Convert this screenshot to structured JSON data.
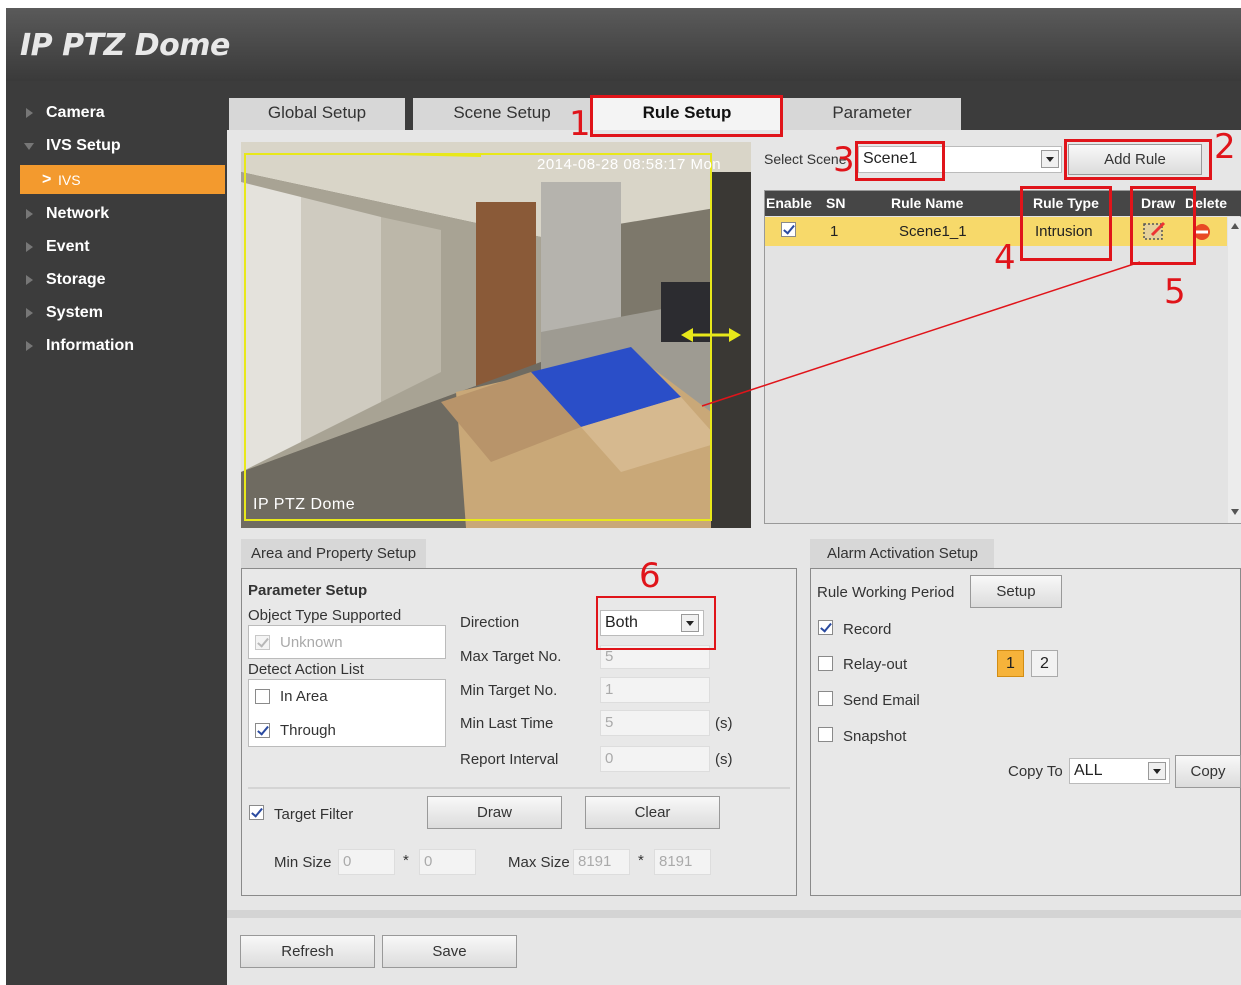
{
  "app": {
    "title": "IP PTZ Dome"
  },
  "sidebar": {
    "items": [
      {
        "label": "Camera"
      },
      {
        "label": "IVS Setup"
      },
      {
        "label": "IVS"
      },
      {
        "label": "Network"
      },
      {
        "label": "Event"
      },
      {
        "label": "Storage"
      },
      {
        "label": "System"
      },
      {
        "label": "Information"
      }
    ]
  },
  "tabs": [
    {
      "label": "Global Setup"
    },
    {
      "label": "Scene Setup"
    },
    {
      "label": "Rule Setup"
    },
    {
      "label": "Parameter"
    }
  ],
  "video": {
    "timestamp": "2014-08-28 08:58:17 Mon",
    "osd_title": "IP PTZ Dome"
  },
  "scene": {
    "label": "Select Scene",
    "value": "Scene1",
    "add_rule": "Add Rule"
  },
  "rule_table": {
    "headers": [
      "Enable",
      "SN",
      "Rule Name",
      "Rule Type",
      "Draw",
      "Delete"
    ],
    "rows": [
      {
        "enabled": true,
        "sn": "1",
        "name": "Scene1_1",
        "type": "Intrusion"
      }
    ]
  },
  "area": {
    "tab": "Area and Property Setup",
    "param_title": "Parameter Setup",
    "object_type_label": "Object Type Supported",
    "object_types": [
      {
        "label": "Unknown",
        "checked": true
      }
    ],
    "detect_label": "Detect Action List",
    "detect_actions": [
      {
        "label": "In Area",
        "checked": false
      },
      {
        "label": "Through",
        "checked": true
      }
    ],
    "direction_label": "Direction",
    "direction_value": "Both",
    "max_target_label": "Max Target No.",
    "max_target_value": "5",
    "min_target_label": "Min Target No.",
    "min_target_value": "1",
    "min_last_label": "Min Last Time",
    "min_last_value": "5",
    "report_label": "Report Interval",
    "report_value": "0",
    "unit": "(s)",
    "target_filter_label": "Target Filter",
    "draw_label": "Draw",
    "clear_label": "Clear",
    "min_size_label": "Min Size",
    "min_size_w": "0",
    "min_size_h": "0",
    "max_size_label": "Max Size",
    "max_size_w": "8191",
    "max_size_h": "8191",
    "times": "*"
  },
  "alarm": {
    "tab": "Alarm Activation Setup",
    "period_label": "Rule Working Period",
    "setup_label": "Setup",
    "record_label": "Record",
    "relay_label": "Relay-out",
    "relay_pages": [
      "1",
      "2"
    ],
    "email_label": "Send Email",
    "snapshot_label": "Snapshot",
    "copy_to_label": "Copy To",
    "copy_to_value": "ALL",
    "copy_label": "Copy"
  },
  "footer": {
    "refresh": "Refresh",
    "save": "Save"
  },
  "annotations": [
    "1",
    "2",
    "3",
    "4",
    "5",
    "6"
  ],
  "colors": {
    "accent": "#f39a2e",
    "annotation": "#e0141a",
    "row_highlight": "#f7d96a",
    "detection_box": "#e8e81a"
  }
}
